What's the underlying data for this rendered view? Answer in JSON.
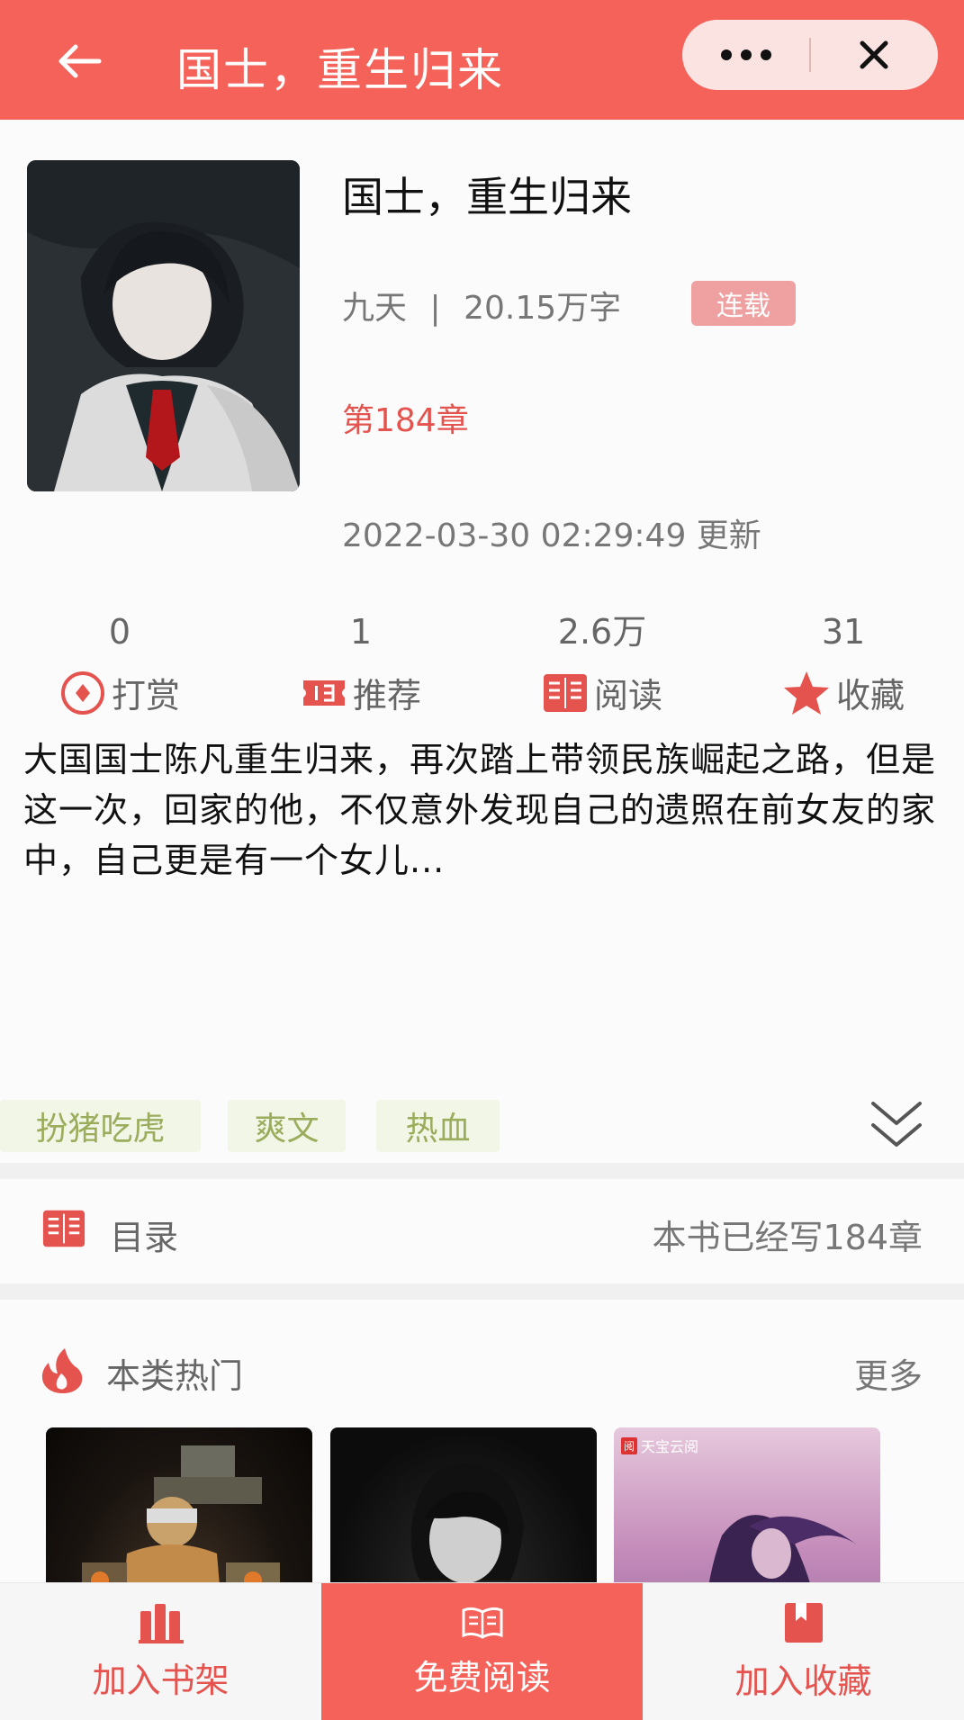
{
  "header": {
    "title": "国士，重生归来",
    "back_icon": "arrow-left-icon",
    "more_icon": "more-dots-icon",
    "close_icon": "close-icon",
    "background": "#f4625a"
  },
  "book": {
    "title": "国士，重生归来",
    "author": "九天",
    "separator": "|",
    "word_count": "20.15万字",
    "status": "连载",
    "latest_chapter": "第184章",
    "update_time": "2022-03-30 02:29:49",
    "update_suffix": "更新"
  },
  "stats": [
    {
      "value": "0",
      "label": "打赏",
      "icon": "reward-icon"
    },
    {
      "value": "1",
      "label": "推荐",
      "icon": "ticket-icon"
    },
    {
      "value": "2.6万",
      "label": "阅读",
      "icon": "book-open-icon"
    },
    {
      "value": "31",
      "label": "收藏",
      "icon": "star-icon"
    }
  ],
  "synopsis": "大国国士陈凡重生归来，再次踏上带领民族崛起之路，但是这一次，回家的他，不仅意外发现自己的遗照在前女友的家中，自己更是有一个女儿...",
  "tags": [
    "扮猪吃虎",
    "爽文",
    "热血"
  ],
  "toc": {
    "label": "目录",
    "count_text": "本书已经写184章"
  },
  "hot": {
    "title": "本类热门",
    "more": "更多",
    "watermark": "天宝云阅",
    "watermark_badge": "阅"
  },
  "bottom_bar": {
    "add_shelf": "加入书架",
    "free_read": "免费阅读",
    "add_favorite": "加入收藏"
  },
  "colors": {
    "accent": "#f4625a",
    "accent_text": "#e5534f",
    "tag_bg": "#f1f6e6",
    "tag_text": "#9bac5c"
  }
}
